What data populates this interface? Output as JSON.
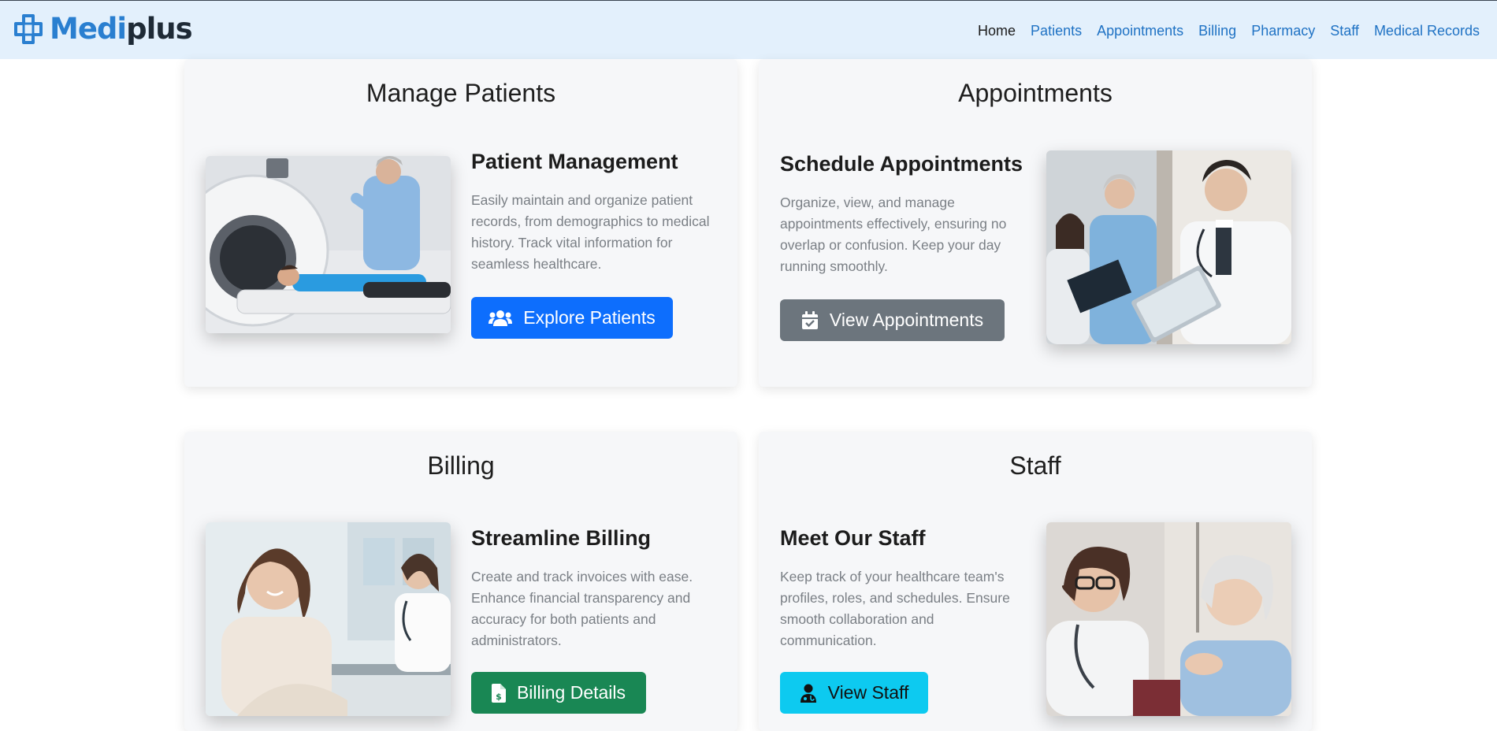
{
  "navbar": {
    "brand_medi": "Medi",
    "brand_plus": "plus",
    "links": [
      {
        "label": "Home",
        "active": true
      },
      {
        "label": "Patients"
      },
      {
        "label": "Appointments"
      },
      {
        "label": "Billing"
      },
      {
        "label": "Pharmacy"
      },
      {
        "label": "Staff"
      },
      {
        "label": "Medical Records"
      }
    ]
  },
  "cards": {
    "patients": {
      "title": "Manage Patients",
      "feature_title": "Patient Management",
      "description": "Easily maintain and organize patient records, from demographics to medical history. Track vital information for seamless healthcare.",
      "button_label": "Explore Patients",
      "button_icon": "users-icon",
      "image": "doctor-with-patient-in-ct-scanner"
    },
    "appointments": {
      "title": "Appointments",
      "feature_title": "Schedule Appointments",
      "description": "Organize, view, and manage appointments effectively, ensuring no overlap or confusion. Keep your day running smoothly.",
      "button_label": "View Appointments",
      "button_icon": "calendar-check-icon",
      "image": "doctors-reviewing-tablet-and-clipboard"
    },
    "billing": {
      "title": "Billing",
      "feature_title": "Streamline Billing",
      "description": "Create and track invoices with ease. Enhance financial transparency and accuracy for both patients and administrators.",
      "button_label": "Billing Details",
      "button_icon": "invoice-dollar-icon",
      "image": "smiling-receptionist-and-doctor"
    },
    "staff": {
      "title": "Staff",
      "feature_title": "Meet Our Staff",
      "description": "Keep track of your healthcare team's profiles, roles, and schedules. Ensure smooth collaboration and communication.",
      "button_label": "View Staff",
      "button_icon": "user-doctor-icon",
      "image": "doctor-comforting-elderly-patient"
    }
  },
  "colors": {
    "navbar_bg": "#e3f0fc",
    "link": "#1f72c4",
    "primary": "#0d6efd",
    "secondary": "#6c757d",
    "success": "#198754",
    "info": "#0dcaf0"
  }
}
